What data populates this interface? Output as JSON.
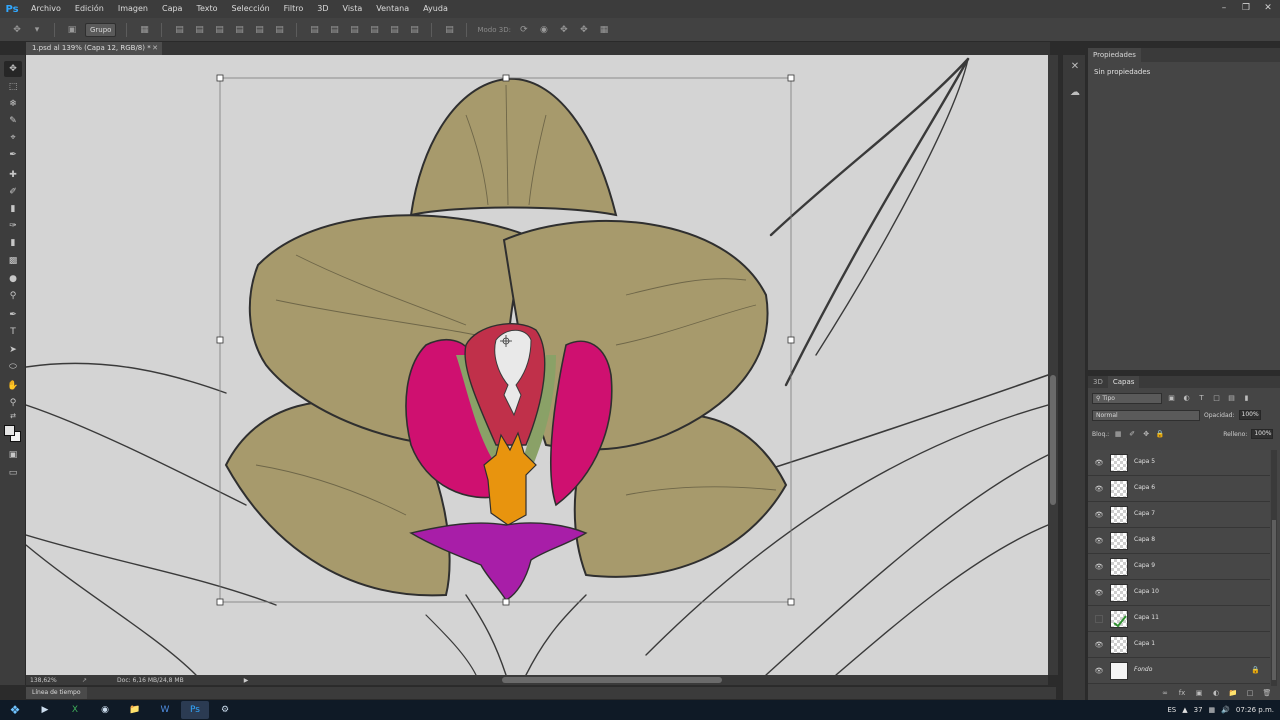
{
  "app": {
    "logo": "Ps"
  },
  "menu": [
    "Archivo",
    "Edición",
    "Imagen",
    "Capa",
    "Texto",
    "Selección",
    "Filtro",
    "3D",
    "Vista",
    "Ventana",
    "Ayuda"
  ],
  "window_controls": [
    "minimize-icon",
    "restore-icon",
    "close-icon"
  ],
  "options": {
    "auto_select_value": "Grupo",
    "mode_3d_label": "Modo 3D:"
  },
  "document": {
    "tab_title": "1.psd al 139% (Capa 12, RGB/8) *",
    "zoom": "138,62%",
    "doc_info": "Doc: 6,16 MB/24,8 MB"
  },
  "timeline": {
    "label": "Línea de tiempo"
  },
  "properties": {
    "tab": "Propiedades",
    "empty_text": "Sin propiedades"
  },
  "layers": {
    "tabs": [
      "3D",
      "Capas"
    ],
    "active_tab": "Capas",
    "filter_kind": "Tipo",
    "blend_mode": "Normal",
    "opacity_label": "Opacidad:",
    "opacity": "100%",
    "lock_label": "Bloq.:",
    "fill_label": "Relleno:",
    "fill": "100%",
    "items": [
      {
        "name": "Capa 5",
        "visible": true,
        "thumb": "transparent"
      },
      {
        "name": "Capa 6",
        "visible": true,
        "thumb": "transparent"
      },
      {
        "name": "Capa 7",
        "visible": true,
        "thumb": "transparent"
      },
      {
        "name": "Capa 8",
        "visible": true,
        "thumb": "transparent"
      },
      {
        "name": "Capa 9",
        "visible": true,
        "thumb": "transparent"
      },
      {
        "name": "Capa 10",
        "visible": true,
        "thumb": "transparent"
      },
      {
        "name": "Capa 11",
        "visible": false,
        "thumb": "green-mark"
      },
      {
        "name": "Capa 1",
        "visible": true,
        "thumb": "transparent"
      },
      {
        "name": "Fondo",
        "visible": true,
        "thumb": "white",
        "locked": true
      }
    ]
  },
  "taskbar": {
    "language": "ES",
    "tray_count": "37",
    "time": "07:26 p.m."
  },
  "colors": {
    "canvas_bg": "#d4d4d4",
    "petal": "#a79a6c",
    "lip_magenta": "#cf1070",
    "labellum": "#a81ea8",
    "column_orange": "#e8940e",
    "green": "#8aa167",
    "crimson": "#c0304a"
  }
}
